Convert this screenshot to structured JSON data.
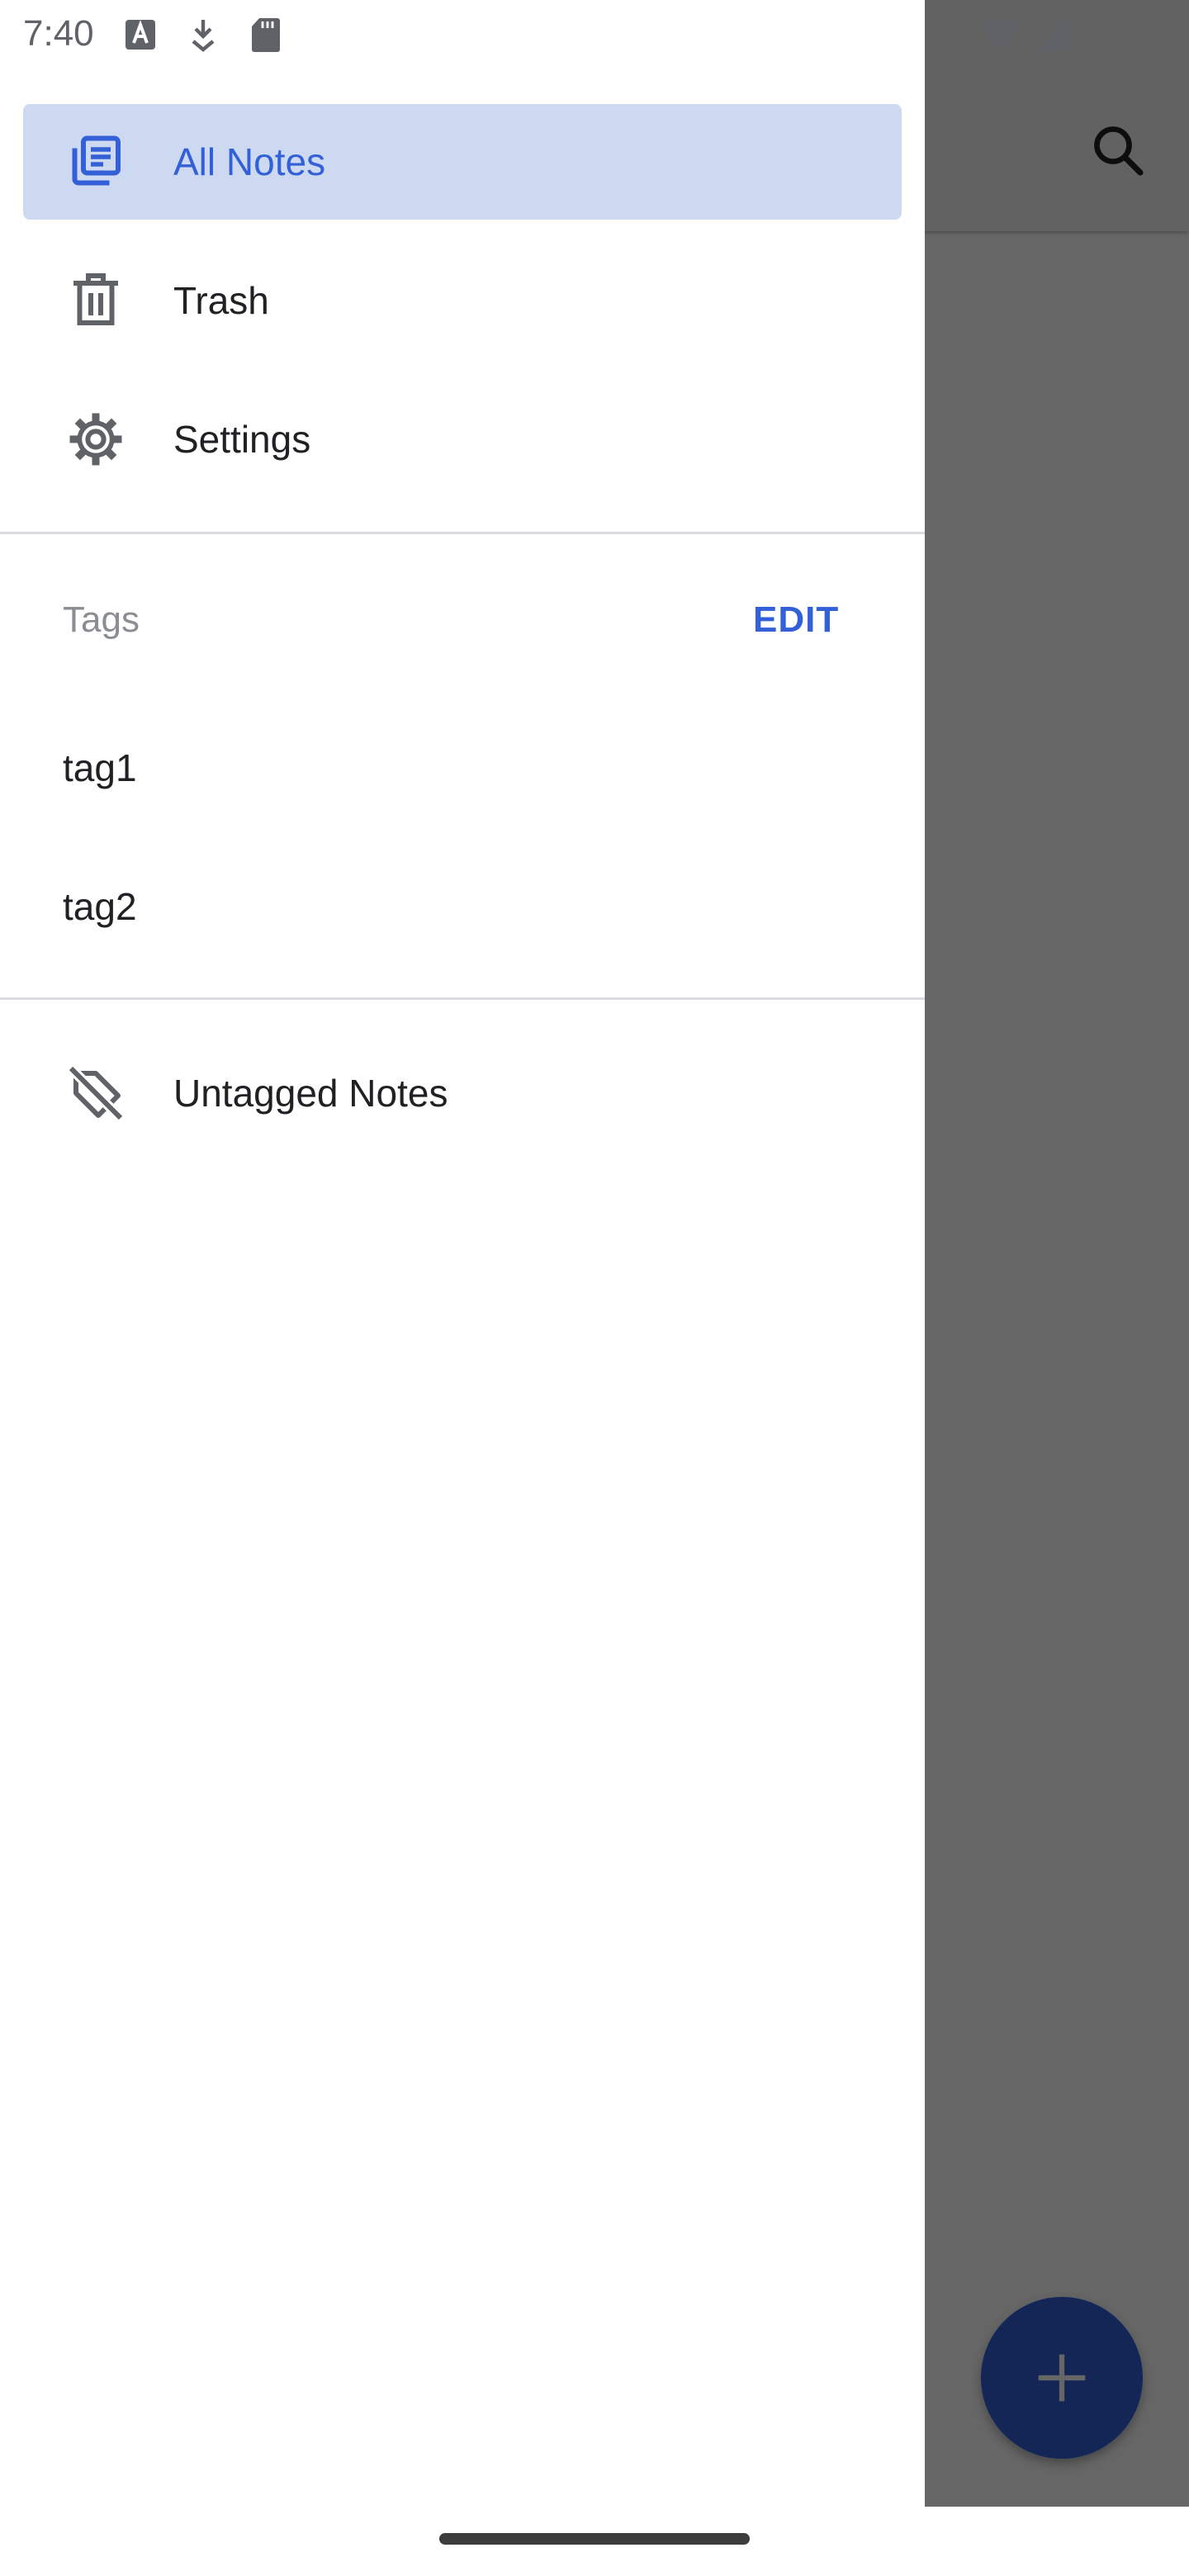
{
  "status_bar": {
    "time": "7:40",
    "icons": [
      "a-font-icon",
      "download-icon",
      "sd-card-icon",
      "wifi-icon",
      "signal-icon"
    ]
  },
  "background": {
    "icons": [
      "search-icon",
      "add-icon"
    ],
    "accent": "#3360d6"
  },
  "drawer": {
    "nav_items": [
      {
        "label": "All Notes",
        "icon": "notes-stack-icon",
        "selected": true
      },
      {
        "label": "Trash",
        "icon": "trash-icon",
        "selected": false
      },
      {
        "label": "Settings",
        "icon": "gear-icon",
        "selected": false
      }
    ],
    "tags": {
      "header": "Tags",
      "edit_label": "EDIT",
      "items": [
        "tag1",
        "tag2"
      ]
    },
    "untagged": {
      "label": "Untagged Notes",
      "icon": "tag-off-icon"
    }
  },
  "colors": {
    "accent": "#3360d6",
    "selected_bg": "#cdd9f1",
    "text": "#202124",
    "muted": "#8a8d91",
    "divider": "#dadce0"
  }
}
